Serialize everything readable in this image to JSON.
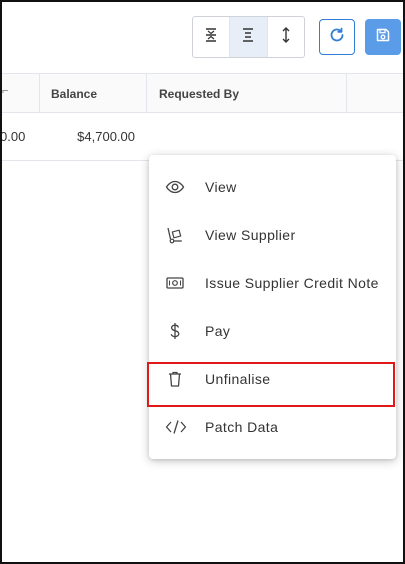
{
  "toolbar": {
    "density_buttons": [
      {
        "icon": "compact-density-icon"
      },
      {
        "icon": "standard-density-icon",
        "active": true
      },
      {
        "icon": "comfortable-density-icon"
      }
    ],
    "refresh_icon": "refresh-icon",
    "save_icon": "save-icon"
  },
  "table": {
    "columns": [
      "",
      "Balance",
      "Requested By"
    ],
    "rows": [
      {
        "prev": "0.00",
        "balance": "$4,700.00",
        "requested_by": ""
      }
    ]
  },
  "context_menu": {
    "items": [
      {
        "label": "View",
        "icon": "eye-icon"
      },
      {
        "label": "View Supplier",
        "icon": "hand-truck-icon"
      },
      {
        "label": "Issue Supplier Credit Note",
        "icon": "banknote-icon"
      },
      {
        "label": "Pay",
        "icon": "dollar-icon"
      },
      {
        "label": "Unfinalise",
        "icon": "trash-icon",
        "highlighted": true
      },
      {
        "label": "Patch Data",
        "icon": "code-icon"
      }
    ]
  },
  "colors": {
    "accent": "#2f7fd8",
    "save_button": "#5a9ce8",
    "highlight_border": "#e01818"
  }
}
